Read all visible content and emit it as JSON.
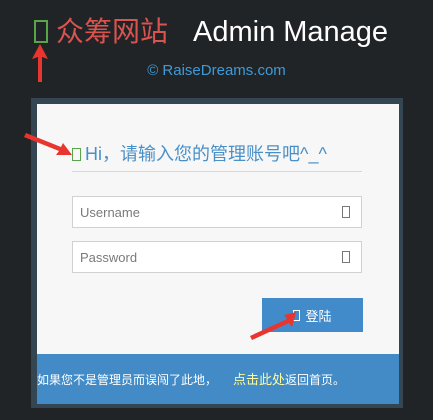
{
  "header": {
    "brand_cn": "众筹网站",
    "brand_en": "Admin Manage",
    "copyright": "© RaiseDreams.com"
  },
  "form": {
    "title": "Hi，请输入您的管理账号吧^_^",
    "username_placeholder": "Username",
    "password_placeholder": "Password",
    "login_label": "登陆"
  },
  "footer": {
    "text_before": "如果您不是管理员而误闯了此地，",
    "link_text": "点击此处",
    "text_after": "返回首页。"
  },
  "colors": {
    "background": "#212427",
    "brand_cn": "#d9534f",
    "accent": "#428bca",
    "icon_green": "#59a64a",
    "link": "#fffb9c",
    "annotation_arrow": "#e8352e"
  },
  "icons": {
    "brand": "placeholder-glyph-icon",
    "title": "placeholder-glyph-icon",
    "username": "user-icon",
    "password": "lock-icon",
    "login": "sign-in-icon"
  }
}
